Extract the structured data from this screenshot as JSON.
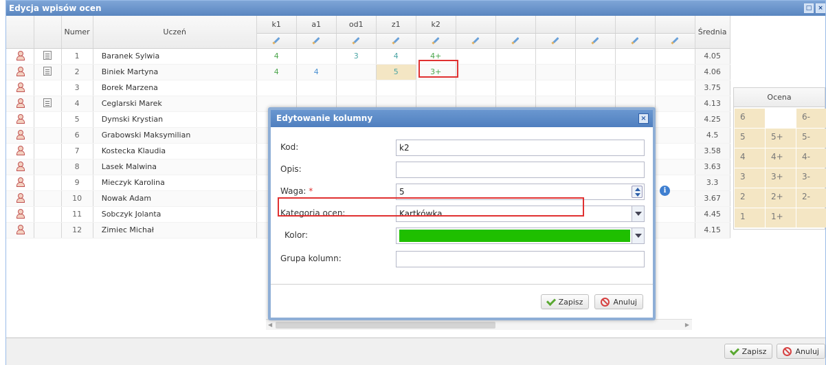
{
  "window": {
    "title": "Edycja wpisów ocen"
  },
  "grid": {
    "headers": {
      "numer": "Numer",
      "uczen": "Uczeń",
      "srednia": "Średnia",
      "columns": [
        "k1",
        "a1",
        "od1",
        "z1",
        "k2",
        "",
        "",
        "",
        "",
        "",
        ""
      ]
    },
    "rows": [
      {
        "num": "1",
        "name": "Baranek Sylwia",
        "note": true,
        "grades": [
          "4",
          "",
          "3",
          "4",
          "4+"
        ],
        "avg": "4.05"
      },
      {
        "num": "2",
        "name": "Biniek Martyna",
        "note": true,
        "grades": [
          "4",
          "4",
          "",
          "5",
          "3+"
        ],
        "avg": "4.06"
      },
      {
        "num": "3",
        "name": "Borek Marzena",
        "note": false,
        "grades": [
          "",
          "",
          "",
          "",
          ""
        ],
        "avg": "3.75"
      },
      {
        "num": "4",
        "name": "Ceglarski Marek",
        "note": true,
        "grades": [
          "",
          "",
          "",
          "",
          ""
        ],
        "avg": "4.13"
      },
      {
        "num": "5",
        "name": "Dymski Krystian",
        "note": false,
        "grades": [
          "",
          "",
          "",
          "",
          ""
        ],
        "avg": "4.25"
      },
      {
        "num": "6",
        "name": "Grabowski Maksymilian",
        "note": false,
        "grades": [
          "",
          "",
          "",
          "",
          ""
        ],
        "avg": "4.5"
      },
      {
        "num": "7",
        "name": "Kostecka Klaudia",
        "note": false,
        "grades": [
          "",
          "",
          "",
          "",
          ""
        ],
        "avg": "3.58"
      },
      {
        "num": "8",
        "name": "Lasek Malwina",
        "note": false,
        "grades": [
          "",
          "",
          "",
          "",
          ""
        ],
        "avg": "3.63"
      },
      {
        "num": "9",
        "name": "Mieczyk Karolina",
        "note": false,
        "grades": [
          "",
          "",
          "",
          "",
          ""
        ],
        "avg": "3.3"
      },
      {
        "num": "10",
        "name": "Nowak Adam",
        "note": false,
        "grades": [
          "",
          "",
          "",
          "",
          ""
        ],
        "avg": "3.67"
      },
      {
        "num": "11",
        "name": "Sobczyk Jolanta",
        "note": false,
        "grades": [
          "",
          "",
          "",
          "",
          ""
        ],
        "avg": "4.45"
      },
      {
        "num": "12",
        "name": "Zimiec Michał",
        "note": false,
        "grades": [
          "",
          "",
          "",
          "",
          ""
        ],
        "avg": "4.15"
      }
    ]
  },
  "ocena": {
    "title": "Ocena",
    "values": [
      "6",
      "",
      "6-",
      "5",
      "5+",
      "5-",
      "4",
      "4+",
      "4-",
      "3",
      "3+",
      "3-",
      "2",
      "2+",
      "2-",
      "1",
      "1+",
      ""
    ]
  },
  "modal": {
    "title": "Edytowanie kolumny",
    "close": "×",
    "labels": {
      "kod": "Kod:",
      "opis": "Opis:",
      "waga": "Waga:",
      "req": "*",
      "kategoria": "Kategoria ocen:",
      "kolor": "Kolor:",
      "grupa": "Grupa kolumn:"
    },
    "values": {
      "kod": "k2",
      "opis": "",
      "waga": "5",
      "kategoria": "Kartkówka",
      "grupa": ""
    },
    "info": "i",
    "color_hex": "#1fbf00",
    "save": "Zapisz",
    "cancel": "Anuluj"
  },
  "footer": {
    "save": "Zapisz",
    "cancel": "Anuluj"
  },
  "colors": {
    "title_bar": "#5a86c0",
    "highlight": "#e03030",
    "grade_cell": "#f4e6c4"
  }
}
